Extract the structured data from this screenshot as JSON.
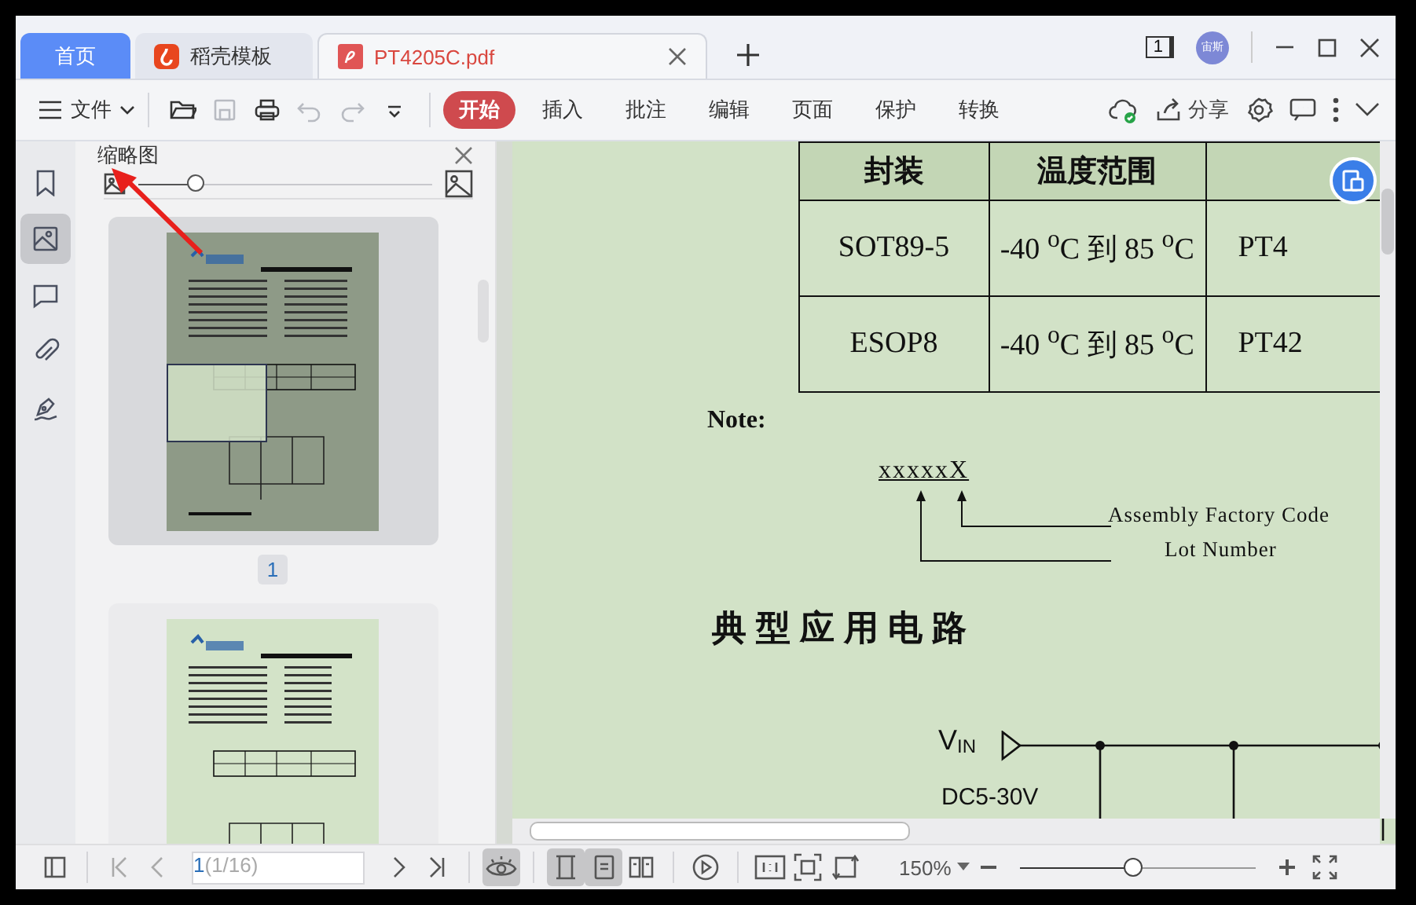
{
  "tabs": [
    {
      "label": "首页",
      "kind": "home",
      "selected": false
    },
    {
      "label": "稻壳模板",
      "kind": "template",
      "selected": false
    },
    {
      "label": "PT4205C.pdf",
      "kind": "pdf",
      "selected": true
    }
  ],
  "account": {
    "badge": "1",
    "avatar": "宙斯"
  },
  "toolbar": {
    "menu": "文件",
    "tools": [
      {
        "kind": "open",
        "disabled": false
      },
      {
        "kind": "save",
        "disabled": true
      },
      {
        "kind": "print",
        "disabled": false
      },
      {
        "kind": "undo",
        "disabled": true
      },
      {
        "kind": "redo",
        "disabled": true
      },
      {
        "kind": "more",
        "disabled": false
      }
    ],
    "ribbon_tabs": [
      {
        "label": "开始",
        "selected": true
      },
      {
        "label": "插入",
        "selected": false
      },
      {
        "label": "批注",
        "selected": false
      },
      {
        "label": "编辑",
        "selected": false
      },
      {
        "label": "页面",
        "selected": false
      },
      {
        "label": "保护",
        "selected": false
      },
      {
        "label": "转换",
        "selected": false
      }
    ],
    "share": "分享"
  },
  "side_rail": [
    {
      "kind": "bookmark",
      "selected": false
    },
    {
      "kind": "thumbnail",
      "selected": true
    },
    {
      "kind": "comment",
      "selected": false
    },
    {
      "kind": "attachment",
      "selected": false
    },
    {
      "kind": "sign",
      "selected": false
    }
  ],
  "thumbnail_panel": {
    "title": "缩略图",
    "size_slider": {
      "level": 0.2
    },
    "pages": [
      {
        "label": "1",
        "selected": true
      },
      {
        "selected": false
      }
    ]
  },
  "document": {
    "table": {
      "columns": [
        "封装",
        "温度范围"
      ],
      "rows": [
        [
          "SOT89-5",
          "-40 $^{o}$C 到 85 $^{o}$C",
          "PT4"
        ],
        [
          "ESOP8",
          "-40 $^{o}$C 到 85 $^{o}$C",
          "PT42"
        ]
      ]
    },
    "note_title": "Note:",
    "code": "xxxxxX",
    "code_labels": [
      "Assembly Factory Code",
      "Lot Number"
    ],
    "heading": "典型应用电路",
    "input_label": "V$_{IN}$",
    "input_range": "DC5-30V"
  },
  "status_bar": {
    "page": "1",
    "page_count": "(1/16)",
    "read_mode": {
      "selected": true
    },
    "view_modes": [
      {
        "kind": "continuous",
        "selected": true
      },
      {
        "kind": "single",
        "selected": true
      },
      {
        "kind": "two-page",
        "selected": false
      }
    ],
    "zoom": "150%",
    "zoom_slider": {
      "level": 0.48
    }
  }
}
